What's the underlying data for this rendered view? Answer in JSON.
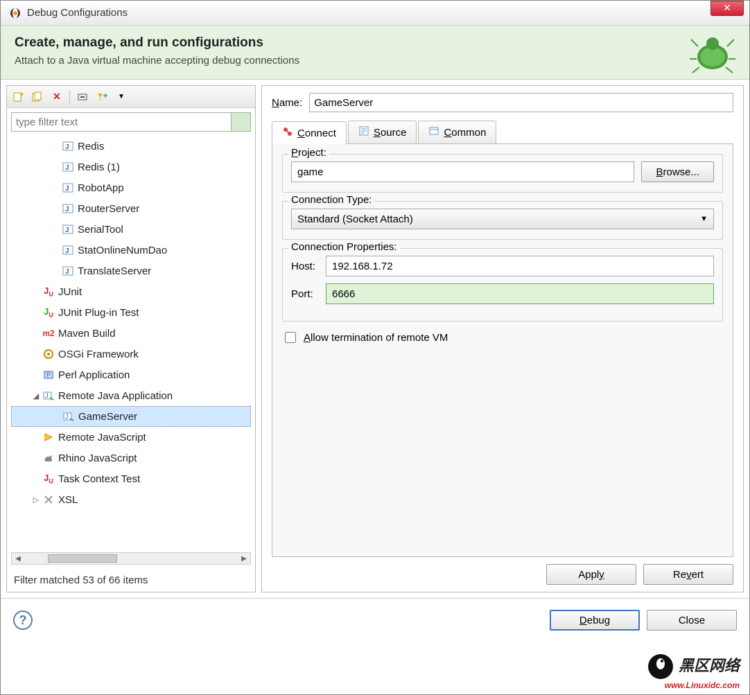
{
  "window": {
    "title": "Debug Configurations",
    "close": "✕"
  },
  "header": {
    "heading": "Create, manage, and run configurations",
    "subtitle": "Attach to a Java virtual machine accepting debug connections"
  },
  "filter": {
    "placeholder": "type filter text",
    "status": "Filter matched 53 of 66 items"
  },
  "tree": [
    {
      "indent": 2,
      "icon": "java-config-icon",
      "label": "Redis"
    },
    {
      "indent": 2,
      "icon": "java-config-icon",
      "label": "Redis (1)"
    },
    {
      "indent": 2,
      "icon": "java-config-icon",
      "label": "RobotApp"
    },
    {
      "indent": 2,
      "icon": "java-config-icon",
      "label": "RouterServer"
    },
    {
      "indent": 2,
      "icon": "java-config-icon",
      "label": "SerialTool"
    },
    {
      "indent": 2,
      "icon": "java-config-icon",
      "label": "StatOnlineNumDao"
    },
    {
      "indent": 2,
      "icon": "java-config-icon",
      "label": "TranslateServer"
    },
    {
      "indent": 1,
      "icon": "junit-icon",
      "label": "JUnit"
    },
    {
      "indent": 1,
      "icon": "junit-plugin-icon",
      "label": "JUnit Plug-in Test"
    },
    {
      "indent": 1,
      "icon": "maven-icon",
      "label": "Maven Build"
    },
    {
      "indent": 1,
      "icon": "osgi-icon",
      "label": "OSGi Framework"
    },
    {
      "indent": 1,
      "icon": "perl-icon",
      "label": "Perl Application"
    },
    {
      "indent": 1,
      "icon": "remote-java-icon",
      "label": "Remote Java Application",
      "expanded": true
    },
    {
      "indent": 2,
      "icon": "remote-java-icon",
      "label": "GameServer",
      "selected": true
    },
    {
      "indent": 1,
      "icon": "remote-js-icon",
      "label": "Remote JavaScript"
    },
    {
      "indent": 1,
      "icon": "rhino-icon",
      "label": "Rhino JavaScript"
    },
    {
      "indent": 1,
      "icon": "junit-icon",
      "label": "Task Context Test"
    },
    {
      "indent": 1,
      "icon": "xsl-icon",
      "label": "XSL",
      "collapsed": true
    }
  ],
  "form": {
    "name_label": "Name:",
    "name_value": "GameServer",
    "tabs": [
      {
        "label": "Connect",
        "icon": "connect-tab-icon",
        "active": true
      },
      {
        "label": "Source",
        "icon": "source-tab-icon"
      },
      {
        "label": "Common",
        "icon": "common-tab-icon"
      }
    ],
    "project": {
      "title": "Project:",
      "value": "game",
      "browse": "Browse..."
    },
    "conn_type": {
      "title": "Connection Type:",
      "value": "Standard (Socket Attach)"
    },
    "conn_props": {
      "title": "Connection Properties:",
      "host_label": "Host:",
      "host_value": "192.168.1.72",
      "port_label": "Port:",
      "port_value": "6666"
    },
    "allow_term": "Allow termination of remote VM",
    "apply": "Apply",
    "revert": "Revert"
  },
  "footer": {
    "debug": "Debug",
    "close": "Close"
  },
  "watermark": {
    "main": "黑区网络",
    "sub": "www.Linuxidc.com"
  }
}
